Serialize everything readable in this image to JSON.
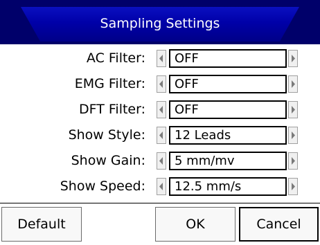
{
  "dialog": {
    "title": "Sampling Settings"
  },
  "settings": [
    {
      "label": "AC Filter:",
      "value": "OFF"
    },
    {
      "label": "EMG Filter:",
      "value": "OFF"
    },
    {
      "label": "DFT Filter:",
      "value": "OFF"
    },
    {
      "label": "Show Style:",
      "value": "12 Leads"
    },
    {
      "label": "Show Gain:",
      "value": "5 mm/mv"
    },
    {
      "label": "Show Speed:",
      "value": "12.5 mm/s"
    }
  ],
  "buttons": {
    "default": "Default",
    "ok": "OK",
    "cancel": "Cancel"
  },
  "icons": {
    "prev": "arrow-left-icon",
    "next": "arrow-right-icon"
  },
  "colors": {
    "title_bar": "#00006a",
    "title_tab": "#0000a8"
  }
}
